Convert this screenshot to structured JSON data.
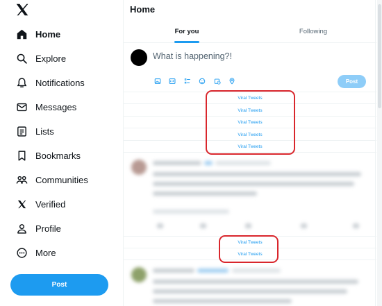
{
  "sidebar": {
    "logo": "x-logo-icon",
    "items": [
      {
        "label": "Home",
        "icon": "home-icon",
        "active": true
      },
      {
        "label": "Explore",
        "icon": "search-icon"
      },
      {
        "label": "Notifications",
        "icon": "bell-icon"
      },
      {
        "label": "Messages",
        "icon": "envelope-icon"
      },
      {
        "label": "Lists",
        "icon": "list-icon"
      },
      {
        "label": "Bookmarks",
        "icon": "bookmark-icon"
      },
      {
        "label": "Communities",
        "icon": "people-icon"
      },
      {
        "label": "Verified",
        "icon": "x-logo-icon"
      },
      {
        "label": "Profile",
        "icon": "person-icon"
      },
      {
        "label": "More",
        "icon": "more-icon"
      }
    ],
    "post_label": "Post"
  },
  "main": {
    "title": "Home",
    "tabs": [
      {
        "label": "For you",
        "active": true
      },
      {
        "label": "Following"
      }
    ],
    "composer": {
      "placeholder": "What is happening?!",
      "toolbar_icons": [
        "image-icon",
        "gif-icon",
        "poll-icon",
        "emoji-icon",
        "schedule-icon",
        "location-icon"
      ],
      "post_label": "Post"
    },
    "viral_group_1": [
      "Viral Tweets",
      "Viral Tweets",
      "Viral Tweets",
      "Viral Tweets",
      "Viral Tweets"
    ],
    "viral_group_2": [
      "Viral Tweets",
      "Viral Tweets"
    ]
  },
  "colors": {
    "accent": "#1d9bf0",
    "post_disabled": "#8ecdf8",
    "annotation": "#d9262c",
    "text": "#0f1419",
    "muted": "#536471"
  }
}
